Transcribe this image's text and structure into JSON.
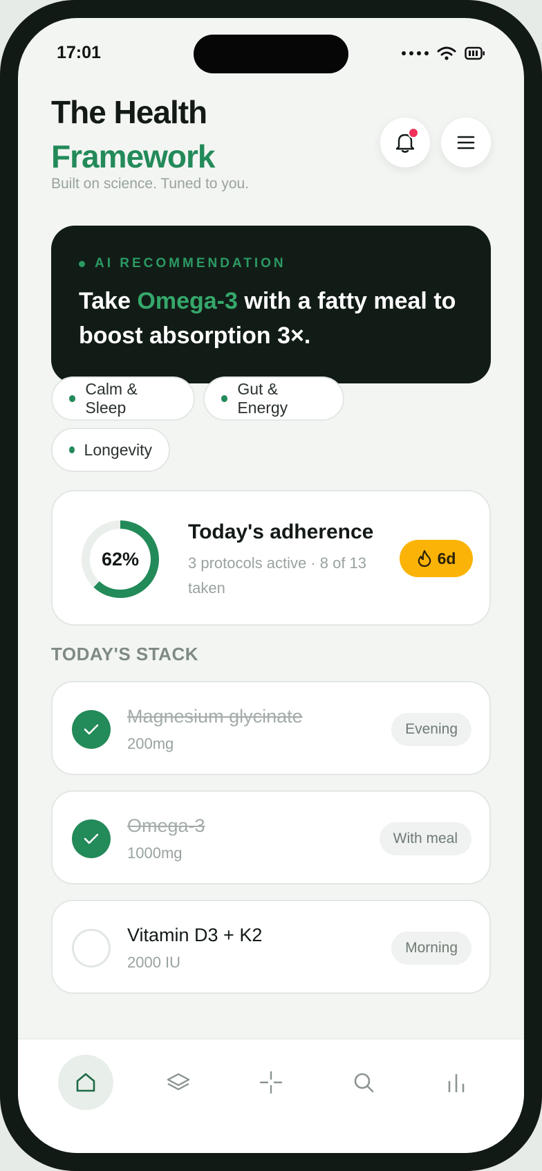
{
  "status_bar": {
    "time": "17:01"
  },
  "header": {
    "title_line1": "The Health",
    "title_line2": "Framework",
    "tagline": "Built on science. Tuned to you."
  },
  "ai_card": {
    "eyebrow": "AI RECOMMENDATION",
    "text_before": "Take ",
    "highlight": "Omega-3",
    "text_after": " with a fatty meal to boost absorption 3×."
  },
  "chips": [
    {
      "label": "Calm & Sleep"
    },
    {
      "label": "Gut & Energy"
    },
    {
      "label": "Longevity"
    }
  ],
  "adherence": {
    "progress_percent": 62,
    "percent_label": "62%",
    "title": "Today's adherence",
    "subtitle": "3 protocols active · 8 of 13 taken",
    "streak_label": "6d"
  },
  "stack": {
    "section_label": "TODAY'S STACK",
    "items": [
      {
        "name": "Magnesium glycinate",
        "dose": "200mg",
        "timing": "Evening",
        "done": true
      },
      {
        "name": "Omega-3",
        "dose": "1000mg",
        "timing": "With meal",
        "done": true
      },
      {
        "name": "Vitamin D3 + K2",
        "dose": "2000 IU",
        "timing": "Morning",
        "done": false
      }
    ]
  },
  "nav": {
    "items": [
      {
        "icon": "home-icon",
        "active": true
      },
      {
        "icon": "layers-icon",
        "active": false
      },
      {
        "icon": "sparkle-icon",
        "active": false
      },
      {
        "icon": "search-icon",
        "active": false
      },
      {
        "icon": "bar-chart-icon",
        "active": false
      }
    ]
  },
  "colors": {
    "accent": "#238a59",
    "dark_card": "#121c16",
    "streak": "#fbb308",
    "notification": "#f0325a"
  }
}
